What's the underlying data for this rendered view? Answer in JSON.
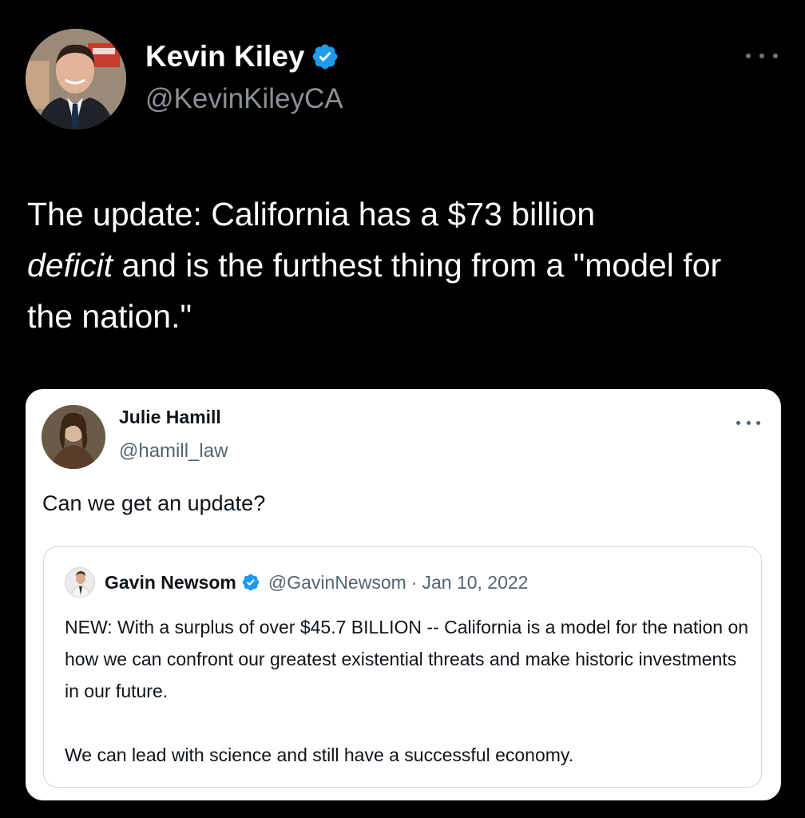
{
  "outer_tweet": {
    "author_name": "Kevin Kiley",
    "handle": "@KevinKileyCA",
    "verified": true,
    "more_icon": "ellipsis-icon",
    "text_part1": "The update: California has a $73 billion",
    "text_italic": "deficit",
    "text_part2": " and is the furthest thing from a \"model for the nation.\""
  },
  "quoted_tweet": {
    "author_name": "Julie Hamill",
    "handle": "@hamill_law",
    "more_icon": "ellipsis-icon",
    "text": "Can we get an update?",
    "nested_quote": {
      "author_name": "Gavin Newsom",
      "verified": true,
      "handle": "@GavinNewsom",
      "separator": "·",
      "date": "Jan 10, 2022",
      "paragraph1": "NEW: With a surplus of over $45.7 BILLION -- California is a model for the nation on how we can confront our greatest existential threats and make historic investments in our future.",
      "paragraph2": "We can lead with science and still have a successful economy."
    }
  },
  "colors": {
    "background": "#000000",
    "verified_blue": "#1d9bf0",
    "card_background": "#ffffff",
    "muted_text": "#536471"
  }
}
